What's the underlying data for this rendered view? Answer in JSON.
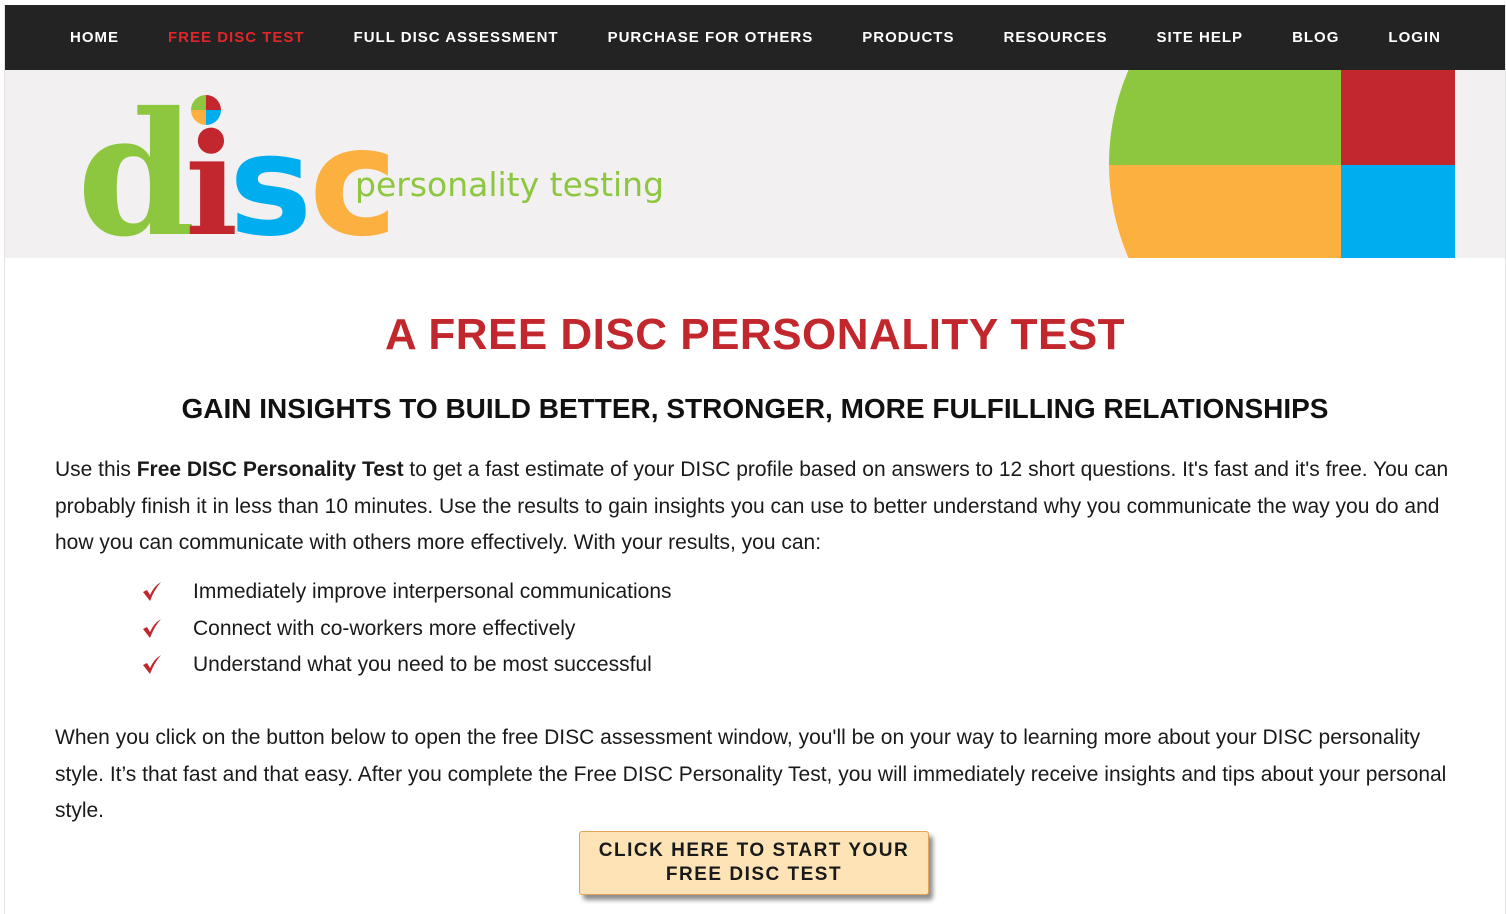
{
  "nav": {
    "items": [
      {
        "label": "HOME"
      },
      {
        "label": "FREE DISC TEST",
        "active": true
      },
      {
        "label": "FULL DISC ASSESSMENT"
      },
      {
        "label": "PURCHASE FOR OTHERS"
      },
      {
        "label": "PRODUCTS"
      },
      {
        "label": "RESOURCES"
      },
      {
        "label": "SITE HELP"
      },
      {
        "label": "BLOG"
      },
      {
        "label": "LOGIN"
      }
    ]
  },
  "logo": {
    "letters": [
      "d",
      "i",
      "s",
      "c"
    ],
    "tagline": "personality testing"
  },
  "colors": {
    "nav_bg": "#232323",
    "nav_active": "#e0262b",
    "heading_red": "#c1272d",
    "green": "#8dc63f",
    "red": "#c1272d",
    "orange": "#fbb040",
    "blue": "#00aeef",
    "button_bg": "#fde3b5"
  },
  "main": {
    "title": "A FREE DISC PERSONALITY TEST",
    "subtitle": "GAIN INSIGHTS TO BUILD BETTER, STRONGER, MORE FULFILLING RELATIONSHIPS",
    "intro_prefix": "Use this ",
    "intro_bold": "Free DISC Personality Test",
    "intro_rest": " to get a fast estimate of your DISC profile based on answers to 12 short questions. It's fast and it's free. You can probably finish it in less than 10 minutes. Use the results to gain insights you can use to better understand why you communicate the way you do and how you can communicate with others more effectively. With your results, you can:",
    "benefits": [
      "Immediately improve interpersonal communications",
      "Connect with co-workers more effectively",
      "Understand what you need to be most successful"
    ],
    "outro": "When you click on the button below to open the free DISC assessment window, you'll be on your way to learning more about your DISC personality style. It’s that fast and that easy. After you complete the Free DISC Personality Test, you will immediately receive insights and tips about your personal style.",
    "cta_line1": "CLICK HERE TO START YOUR",
    "cta_line2": "FREE DISC TEST"
  }
}
